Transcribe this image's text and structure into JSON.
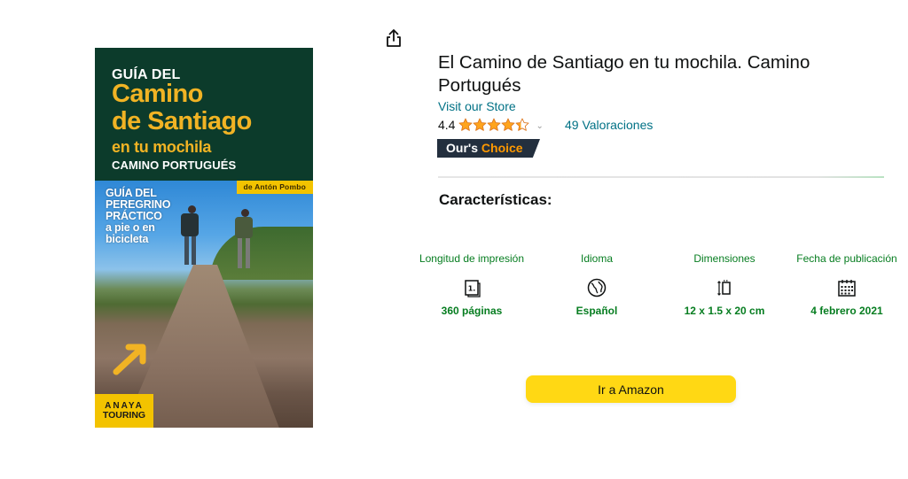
{
  "cover": {
    "title_line1": "GUÍA DEL",
    "title_line2": "Camino",
    "title_line3": "de Santiago",
    "title_line4": "en tu mochila",
    "title_line5": "CAMINO PORTUGUÉS",
    "author": "de Antón Pombo",
    "subtitle_lines": [
      "GUÍA DEL",
      "PEREGRINO",
      "PRÁCTICO",
      "a pie o en",
      "bicicleta"
    ],
    "publisher_line1": "ANAYA",
    "publisher_line2": "TOURING"
  },
  "share": {
    "icon": "share-icon"
  },
  "product": {
    "title": "El Camino de Santiago en tu mochila. Camino Portugués",
    "store_link": "Visit our Store",
    "rating_value": "4.4",
    "rating_stars": 4.4,
    "ratings_count": "49 Valoraciones",
    "badge_part1": "Our's ",
    "badge_part2": "Choice"
  },
  "features": {
    "title": "Características:",
    "items": [
      {
        "label": "Longitud de impresión",
        "icon": "pages-icon",
        "value": "360 páginas"
      },
      {
        "label": "Idioma",
        "icon": "globe-icon",
        "value": "Español"
      },
      {
        "label": "Dimensiones",
        "icon": "dimensions-icon",
        "value": "12 x 1.5 x 20 cm"
      },
      {
        "label": "Fecha de publicación",
        "icon": "calendar-icon",
        "value": "4 febrero 2021"
      }
    ]
  },
  "cta": {
    "label": "Ir a Amazon"
  },
  "colors": {
    "link": "#007185",
    "accent_green": "#067d20",
    "star": "#ffa41c",
    "badge_bg": "#232f3e",
    "badge_accent": "#ff9900",
    "cta_bg": "#ffd814"
  }
}
